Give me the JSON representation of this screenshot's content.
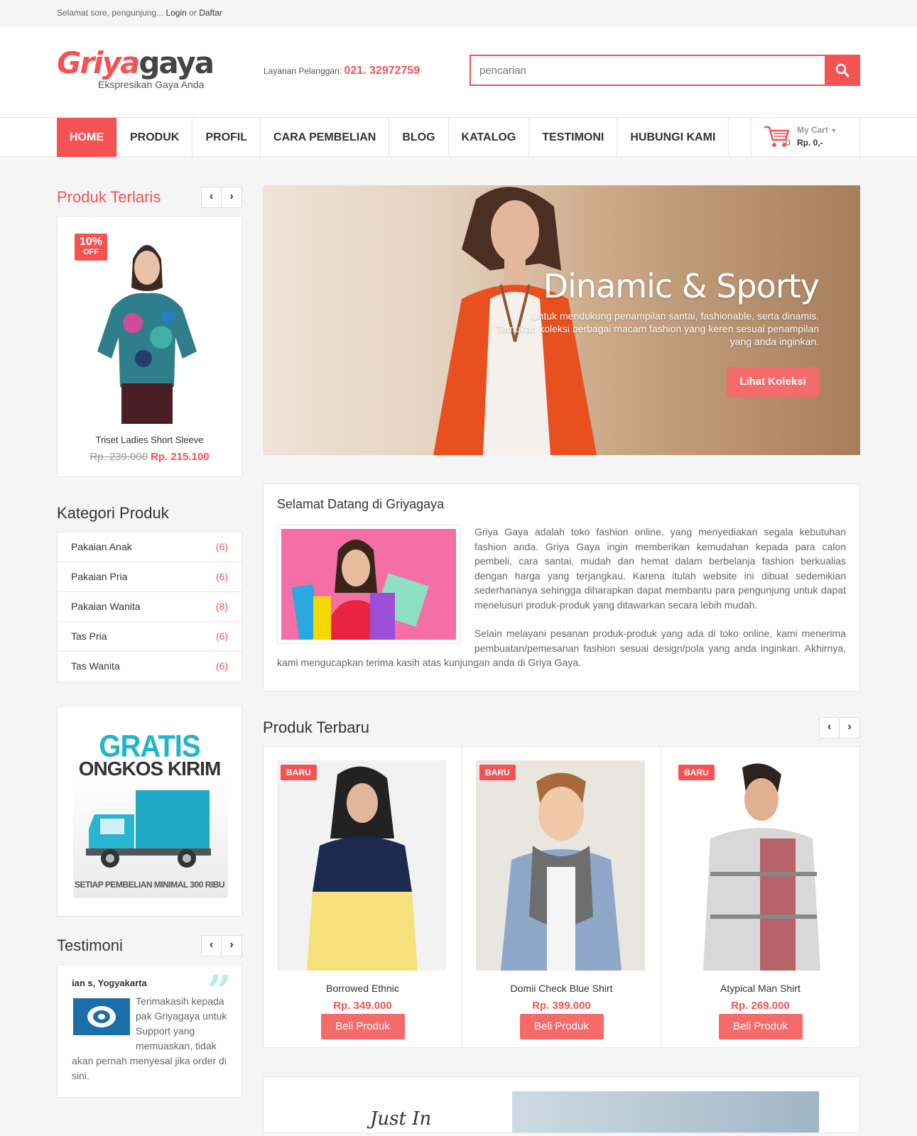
{
  "topbar": {
    "greeting": "Selamat sore, pengunjung...",
    "login": "Login",
    "or": "or",
    "register": "Daftar"
  },
  "header": {
    "logo_part1": "Griya",
    "logo_part2": "gaya",
    "tagline": "Ekspresikan Gaya Anda",
    "service_label": "Layanan Pelanggan:",
    "service_phone": "021. 32972759",
    "search_placeholder": "pencarian"
  },
  "nav": {
    "items": [
      "HOME",
      "PRODUK",
      "PROFIL",
      "CARA PEMBELIAN",
      "BLOG",
      "KATALOG",
      "TESTIMONI",
      "HUBUNGI KAMI"
    ],
    "cart_label": "My Cart",
    "cart_count": "0",
    "cart_total": "Rp. 0,-"
  },
  "bestseller": {
    "title": "Produk Terlaris",
    "badge_pct": "10%",
    "badge_off": "OFF",
    "name": "Triset Ladies Short Sleeve",
    "old_price": "Rp. 239.000",
    "new_price": "Rp. 215.100"
  },
  "categories": {
    "title": "Kategori Produk",
    "items": [
      {
        "name": "Pakaian Anak",
        "count": "(6)"
      },
      {
        "name": "Pakaian Pria",
        "count": "(6)"
      },
      {
        "name": "Pakaian Wanita",
        "count": "(8)"
      },
      {
        "name": "Tas Pria",
        "count": "(6)"
      },
      {
        "name": "Tas Wanita",
        "count": "(6)"
      }
    ]
  },
  "promo": {
    "line1": "GRATIS",
    "line2": "ONGKOS KIRIM",
    "line3": "SETIAP PEMBELIAN MINIMAL 300 RIBU"
  },
  "testimoni": {
    "title": "Testimoni",
    "author": "ian s, Yogyakarta",
    "text": "Terimakasih kepada pak Griyagaya untuk Support yang memuaskan, tidak akan pernah menyesal jika order di sini."
  },
  "slider": {
    "title": "Dinamic & Sporty",
    "desc": "Untuk mendukung penampilan santai, fashionable, serta dinamis. Temukan koleksi berbagai macam fashion yang keren sesuai penampilan yang anda inginkan.",
    "button": "Lihat Koleksi"
  },
  "welcome": {
    "title": "Selamat Datang di Griyagaya",
    "p1": "Griya Gaya adalah toko fashion online, yang menyediakan segala kebutuhan fashion anda. Griya Gaya  ingin memberikan kemudahan kepada para calon pembeli, cara santai, mudah dan hemat dalam berbelanja fashion berkualias dengan harga yang terjangkau. Karena itulah website ini dibuat sedemikian sederhananya sehingga diharapkan dapat membantu para pengunjung untuk dapat menelusuri produk-produk yang ditawarkan secara lebih mudah.",
    "p2": "Selain melayani pesanan produk-produk yang ada di toko online, kami menerima pembuatan/pemesanan fashion sesuai design/pola  yang anda inginkan. Akhirnya, kami mengucapkan terima kasih atas kunjungan anda di Griya Gaya."
  },
  "new_products": {
    "title": "Produk Terbaru",
    "badge": "BARU",
    "buy_label": "Beli Produk",
    "items": [
      {
        "name": "Borrowed Ethnic",
        "price": "Rp. 349.000"
      },
      {
        "name": "Domii Check Blue Shirt",
        "price": "Rp. 399.000"
      },
      {
        "name": "Atypical Man Shirt",
        "price": "Rp. 269.000"
      }
    ]
  },
  "banner2": {
    "script": "Just In"
  },
  "colors": {
    "accent": "#f65254",
    "button": "#f56a6b",
    "promo_cyan": "#1fb6c9"
  }
}
